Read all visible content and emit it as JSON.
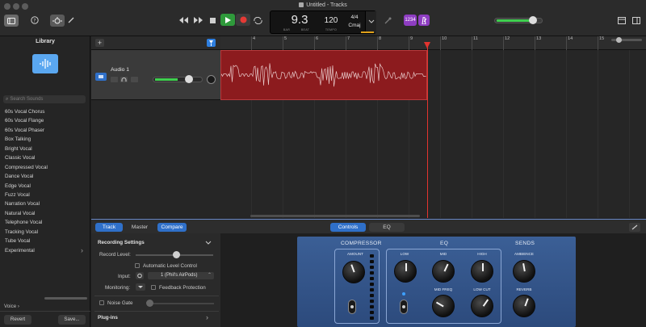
{
  "window": {
    "title": "Untitled - Tracks"
  },
  "lcd": {
    "bar": "9.3",
    "bar_label": "BAR",
    "beat_label": "BEAT",
    "tempo": "120",
    "tempo_label": "TEMPO",
    "signature": "4/4",
    "key": "Cmaj"
  },
  "toolbar": {
    "count_in": "1234"
  },
  "library": {
    "title": "Library",
    "search_placeholder": "Search Sounds",
    "items": [
      "60s Vocal Chorus",
      "60s Vocal Flange",
      "60s Vocal Phaser",
      "Box Talking",
      "Bright Vocal",
      "Classic Vocal",
      "Compressed Vocal",
      "Dance Vocal",
      "Edge Vocal",
      "Fuzz Vocal",
      "Narration Vocal",
      "Natural Vocal",
      "Telephone Vocal",
      "Tracking Vocal",
      "Tube Vocal",
      "Experimental"
    ],
    "breadcrumb": "Voice",
    "revert_label": "Revert",
    "save_label": "Save..."
  },
  "ruler": {
    "marks": [
      "4",
      "5",
      "6",
      "7",
      "8",
      "9",
      "10",
      "11",
      "12",
      "13",
      "14",
      "15"
    ]
  },
  "track": {
    "name": "Audio 1"
  },
  "editor": {
    "tabs": {
      "track": "Track",
      "master": "Master",
      "compare": "Compare",
      "controls": "Controls",
      "eq": "EQ"
    },
    "recording_settings": "Recording Settings",
    "record_level": "Record Level:",
    "auto_level": "Automatic Level Control",
    "input_label": "Input:",
    "input_value": "1  (Phil's AirPods)",
    "monitoring_label": "Monitoring:",
    "feedback": "Feedback Protection",
    "noise_gate": "Noise Gate",
    "plugins": "Plug-ins"
  },
  "plugin": {
    "compressor": "COMPRESSOR",
    "eq": "EQ",
    "sends": "SENDS",
    "amount": "AMOUNT",
    "low": "LOW",
    "mid": "MID",
    "high": "HIGH",
    "mid_freq": "MID FREQ",
    "low_cut": "LOW CUT",
    "ambience": "AMBIENCE",
    "reverb": "REVERB"
  },
  "colors": {
    "accent": "#2f70c9",
    "region": "#8c1b1e",
    "playhead": "#e3342f",
    "plugin_bg": "#345589"
  }
}
